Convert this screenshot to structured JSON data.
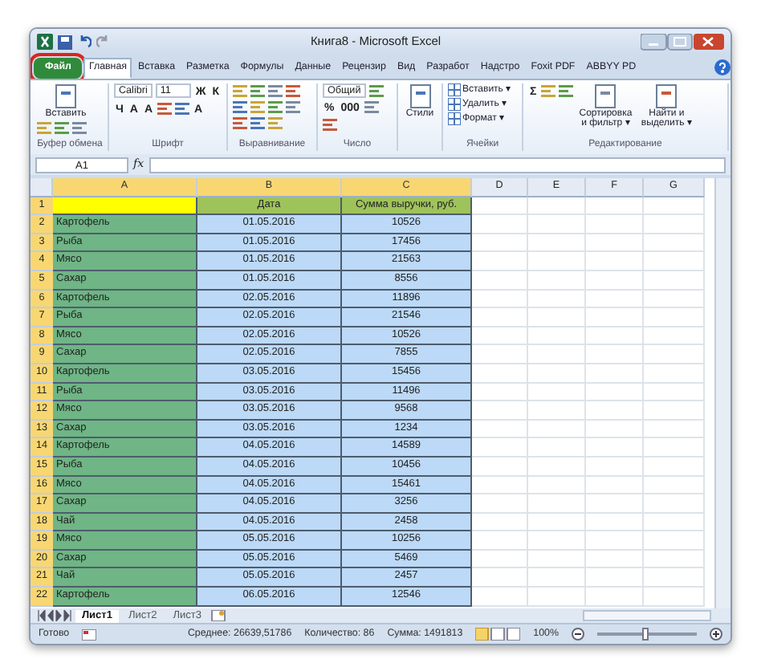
{
  "window": {
    "title": "Книга8 - Microsoft Excel"
  },
  "tabs": [
    {
      "label": "Файл",
      "kind": "file",
      "selected": false,
      "highlighted": true
    },
    {
      "label": "Главная",
      "kind": "tab",
      "selected": true
    },
    {
      "label": "Вставка",
      "kind": "tab",
      "selected": false
    },
    {
      "label": "Разметка",
      "kind": "tab",
      "selected": false
    },
    {
      "label": "Формулы",
      "kind": "tab",
      "selected": false
    },
    {
      "label": "Данные",
      "kind": "tab",
      "selected": false
    },
    {
      "label": "Рецензир",
      "kind": "tab",
      "selected": false
    },
    {
      "label": "Вид",
      "kind": "tab",
      "selected": false
    },
    {
      "label": "Разработ",
      "kind": "tab",
      "selected": false
    },
    {
      "label": "Надстро",
      "kind": "tab",
      "selected": false
    },
    {
      "label": "Foxit PDF",
      "kind": "tab",
      "selected": false
    },
    {
      "label": "ABBYY PD",
      "kind": "tab",
      "selected": false
    }
  ],
  "ribbon": {
    "groups": [
      {
        "label": "Буфер обмена",
        "controls": [
          {
            "kind": "large",
            "text": "Вставить"
          },
          {
            "kind": "icon"
          },
          {
            "kind": "icon"
          },
          {
            "kind": "icon"
          }
        ]
      },
      {
        "label": "Шрифт",
        "controls": [
          {
            "kind": "field",
            "text": "Calibri"
          },
          {
            "kind": "field",
            "text": "11"
          },
          {
            "kind": "glyph",
            "text": "Ж"
          },
          {
            "kind": "glyph",
            "text": "К"
          },
          {
            "kind": "glyph",
            "text": "Ч"
          },
          {
            "kind": "glyph",
            "text": "A"
          },
          {
            "kind": "glyph",
            "text": "A"
          },
          {
            "kind": "icon"
          },
          {
            "kind": "icon"
          },
          {
            "kind": "glyph",
            "text": "A"
          }
        ]
      },
      {
        "label": "Выравнивание",
        "controls": [
          {
            "kind": "icon"
          },
          {
            "kind": "icon"
          },
          {
            "kind": "icon"
          },
          {
            "kind": "icon"
          },
          {
            "kind": "icon"
          },
          {
            "kind": "icon"
          },
          {
            "kind": "icon"
          },
          {
            "kind": "icon"
          },
          {
            "kind": "icon"
          },
          {
            "kind": "icon"
          },
          {
            "kind": "icon"
          }
        ]
      },
      {
        "label": "Число",
        "controls": [
          {
            "kind": "field",
            "text": "Общий"
          },
          {
            "kind": "icon"
          },
          {
            "kind": "glyph",
            "text": "%"
          },
          {
            "kind": "glyph",
            "text": "000"
          },
          {
            "kind": "icon"
          },
          {
            "kind": "icon"
          }
        ]
      },
      {
        "controls": [
          {
            "kind": "large",
            "text": "Стили"
          }
        ]
      },
      {
        "label": "Ячейки",
        "controls": [
          {
            "kind": "small",
            "text": "Вставить ▾"
          },
          {
            "kind": "small",
            "text": "Удалить ▾"
          },
          {
            "kind": "small",
            "text": "Формат ▾"
          }
        ]
      },
      {
        "label": "Редактирование",
        "controls": [
          {
            "kind": "glyph",
            "text": "Σ"
          },
          {
            "kind": "icon"
          },
          {
            "kind": "icon"
          },
          {
            "kind": "large",
            "text": "Сортировка и фильтр ▾"
          },
          {
            "kind": "large",
            "text": "Найти и выделить ▾"
          }
        ]
      }
    ]
  },
  "formula_bar": {
    "name_box": "A1",
    "fx": "fx"
  },
  "columns": [
    {
      "label": "A",
      "selected": true,
      "color": "#6fb585"
    },
    {
      "label": "B",
      "selected": true,
      "color": "#bcd9f7"
    },
    {
      "label": "C",
      "selected": true,
      "color": "#bcd9f7"
    },
    {
      "label": "D",
      "selected": false
    },
    {
      "label": "E",
      "selected": false
    },
    {
      "label": "F",
      "selected": false
    },
    {
      "label": "G",
      "selected": false
    }
  ],
  "header_row": {
    "number": "1",
    "selected": true,
    "cells": [
      {
        "text": "",
        "color": "#ffff00"
      },
      {
        "text": "Дата",
        "color": "#9fc35b"
      },
      {
        "text": "Сумма выручки, руб.",
        "color": "#9fc35b"
      }
    ]
  },
  "rows": [
    {
      "number": "2",
      "selected": true,
      "cells": [
        "Картофель",
        "01.05.2016",
        "10526"
      ]
    },
    {
      "number": "3",
      "selected": true,
      "cells": [
        "Рыба",
        "01.05.2016",
        "17456"
      ]
    },
    {
      "number": "4",
      "selected": true,
      "cells": [
        "Мясо",
        "01.05.2016",
        "21563"
      ]
    },
    {
      "number": "5",
      "selected": true,
      "cells": [
        "Сахар",
        "01.05.2016",
        "8556"
      ]
    },
    {
      "number": "6",
      "selected": true,
      "cells": [
        "Картофель",
        "02.05.2016",
        "11896"
      ]
    },
    {
      "number": "7",
      "selected": true,
      "cells": [
        "Рыба",
        "02.05.2016",
        "21546"
      ]
    },
    {
      "number": "8",
      "selected": true,
      "cells": [
        "Мясо",
        "02.05.2016",
        "10526"
      ]
    },
    {
      "number": "9",
      "selected": true,
      "cells": [
        "Сахар",
        "02.05.2016",
        "7855"
      ]
    },
    {
      "number": "10",
      "selected": true,
      "cells": [
        "Картофель",
        "03.05.2016",
        "15456"
      ]
    },
    {
      "number": "11",
      "selected": true,
      "cells": [
        "Рыба",
        "03.05.2016",
        "11496"
      ]
    },
    {
      "number": "12",
      "selected": true,
      "cells": [
        "Мясо",
        "03.05.2016",
        "9568"
      ]
    },
    {
      "number": "13",
      "selected": true,
      "cells": [
        "Сахар",
        "03.05.2016",
        "1234"
      ]
    },
    {
      "number": "14",
      "selected": true,
      "cells": [
        "Картофель",
        "04.05.2016",
        "14589"
      ]
    },
    {
      "number": "15",
      "selected": true,
      "cells": [
        "Рыба",
        "04.05.2016",
        "10456"
      ]
    },
    {
      "number": "16",
      "selected": true,
      "cells": [
        "Мясо",
        "04.05.2016",
        "15461"
      ]
    },
    {
      "number": "17",
      "selected": true,
      "cells": [
        "Сахар",
        "04.05.2016",
        "3256"
      ]
    },
    {
      "number": "18",
      "selected": true,
      "cells": [
        "Чай",
        "04.05.2016",
        "2458"
      ]
    },
    {
      "number": "19",
      "selected": true,
      "cells": [
        "Мясо",
        "05.05.2016",
        "10256"
      ]
    },
    {
      "number": "20",
      "selected": true,
      "cells": [
        "Сахар",
        "05.05.2016",
        "5469"
      ]
    },
    {
      "number": "21",
      "selected": true,
      "cells": [
        "Чай",
        "05.05.2016",
        "2457"
      ]
    },
    {
      "number": "22",
      "selected": true,
      "cells": [
        "Картофель",
        "06.05.2016",
        "12546"
      ]
    }
  ],
  "sheet_tabs": [
    {
      "label": "Лист1",
      "selected": true
    },
    {
      "label": "Лист2",
      "selected": false
    },
    {
      "label": "Лист3",
      "selected": false
    }
  ],
  "status_bar": {
    "state": "Готово",
    "average": "Среднее: 26639,51786",
    "count": "Количество: 86",
    "sum": "Сумма: 1491813",
    "zoom": "100%",
    "zoom_slider": {
      "level": 0.5
    }
  }
}
